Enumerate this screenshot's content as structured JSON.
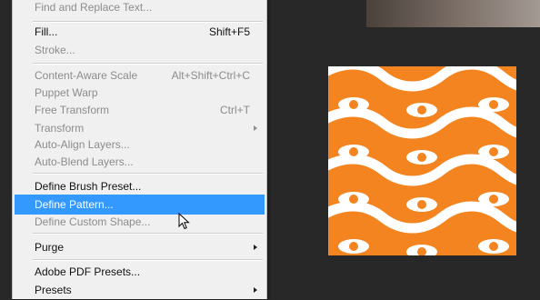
{
  "menu": {
    "items": [
      {
        "label": "Find and Replace Text...",
        "shortcut": ""
      },
      {
        "label": "Fill...",
        "shortcut": "Shift+F5"
      },
      {
        "label": "Stroke...",
        "shortcut": ""
      },
      {
        "label": "Content-Aware Scale",
        "shortcut": "Alt+Shift+Ctrl+C"
      },
      {
        "label": "Puppet Warp",
        "shortcut": ""
      },
      {
        "label": "Free Transform",
        "shortcut": "Ctrl+T"
      },
      {
        "label": "Transform",
        "shortcut": ""
      },
      {
        "label": "Auto-Align Layers...",
        "shortcut": ""
      },
      {
        "label": "Auto-Blend Layers...",
        "shortcut": ""
      },
      {
        "label": "Define Brush Preset...",
        "shortcut": ""
      },
      {
        "label": "Define Pattern...",
        "shortcut": ""
      },
      {
        "label": "Define Custom Shape...",
        "shortcut": ""
      },
      {
        "label": "Purge",
        "shortcut": ""
      },
      {
        "label": "Adobe PDF Presets...",
        "shortcut": ""
      },
      {
        "label": "Presets",
        "shortcut": ""
      }
    ]
  },
  "canvas": {
    "pattern_color": "#f38420",
    "pattern_fg": "#ffffff"
  },
  "colors": {
    "menu_bg": "#f0f0f0",
    "highlight": "#3399ff",
    "workspace": "#282828"
  },
  "icons": {
    "submenu": "chevron-right-icon",
    "pointer": "arrow-pointer-icon"
  }
}
